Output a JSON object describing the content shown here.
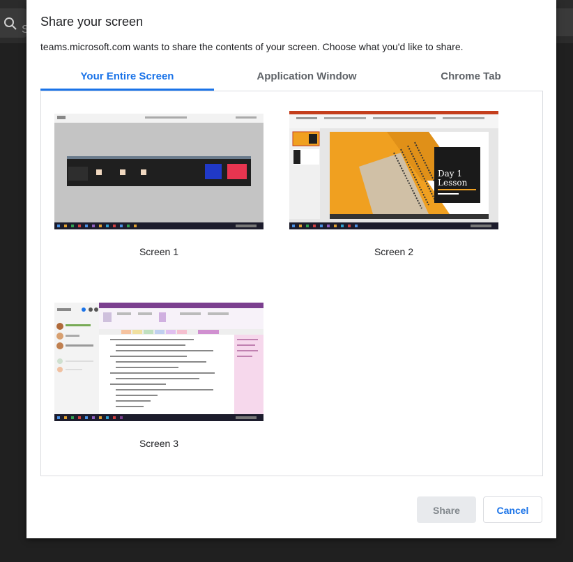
{
  "background": {
    "search_placeholder": "S"
  },
  "dialog": {
    "title": "Share your screen",
    "subtitle": "teams.microsoft.com wants to share the contents of your screen. Choose what you'd like to share.",
    "tabs": [
      {
        "label": "Your Entire Screen",
        "active": true
      },
      {
        "label": "Application Window",
        "active": false
      },
      {
        "label": "Chrome Tab",
        "active": false
      }
    ],
    "screens": [
      {
        "label": "Screen 1"
      },
      {
        "label": "Screen 2",
        "slide_title_line1": "Day 1",
        "slide_title_line2": "Lesson"
      },
      {
        "label": "Screen 3"
      }
    ],
    "buttons": {
      "share": "Share",
      "cancel": "Cancel"
    }
  },
  "colors": {
    "accent": "#1a73e8",
    "slide_orange": "#f0a020",
    "powerpoint_red": "#c43e1c",
    "onenote_purple": "#7b3f8f",
    "teams_blue": "#2039c8",
    "teams_red": "#e83550"
  }
}
